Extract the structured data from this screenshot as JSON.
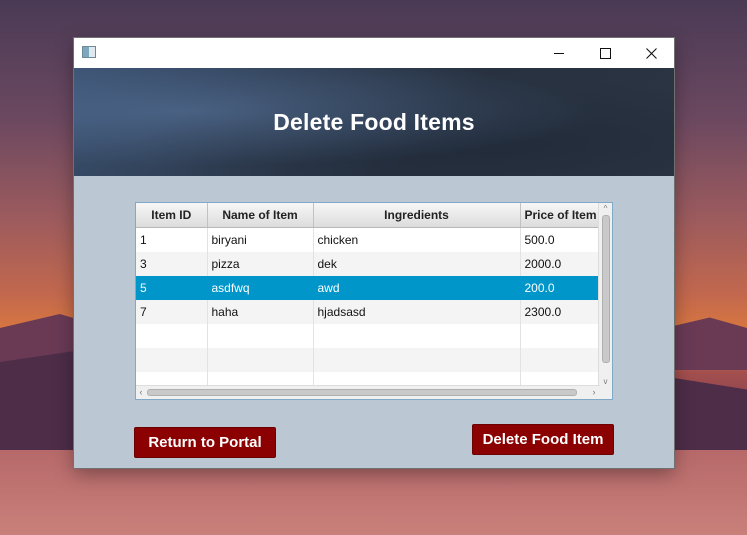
{
  "window": {
    "title": "",
    "controls": {
      "minimize": "minimize-icon",
      "maximize": "maximize-icon",
      "close": "close-icon"
    }
  },
  "header": {
    "title": "Delete Food Items"
  },
  "table": {
    "columns": [
      "Item ID",
      "Name of Item",
      "Ingredients",
      "Price of Item"
    ],
    "rows": [
      {
        "id": "1",
        "name": "biryani",
        "ingredients": "chicken",
        "price": "500.0"
      },
      {
        "id": "3",
        "name": "pizza",
        "ingredients": "dek",
        "price": "2000.0"
      },
      {
        "id": "5",
        "name": "asdfwq",
        "ingredients": "awd",
        "price": "200.0"
      },
      {
        "id": "7",
        "name": "haha",
        "ingredients": "hjadsasd",
        "price": "2300.0"
      }
    ],
    "selected_row": "5"
  },
  "buttons": {
    "return": "Return to Portal",
    "delete": "Delete Food Item"
  },
  "colors": {
    "button": "#8b0000",
    "selection": "#0096c9",
    "panel": "#bbc8d3"
  }
}
